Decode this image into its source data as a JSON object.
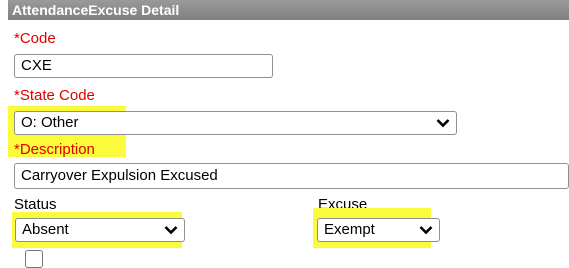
{
  "header": {
    "title": "AttendanceExcuse Detail"
  },
  "code": {
    "label": "Code",
    "value": "CXE"
  },
  "state_code": {
    "label": "State Code",
    "value": "O: Other"
  },
  "description": {
    "label": "Description",
    "value": "Carryover Expulsion Excused"
  },
  "status": {
    "label": "Status",
    "value": "Absent"
  },
  "excuse": {
    "label": "Excuse",
    "value": "Exempt"
  },
  "required_marker": "*",
  "colors": {
    "required": "#e00000",
    "highlight": "#fbfb3c",
    "header_bg": "#8a8a8a"
  },
  "icons": {
    "dropdown": "chevron-down-icon"
  }
}
